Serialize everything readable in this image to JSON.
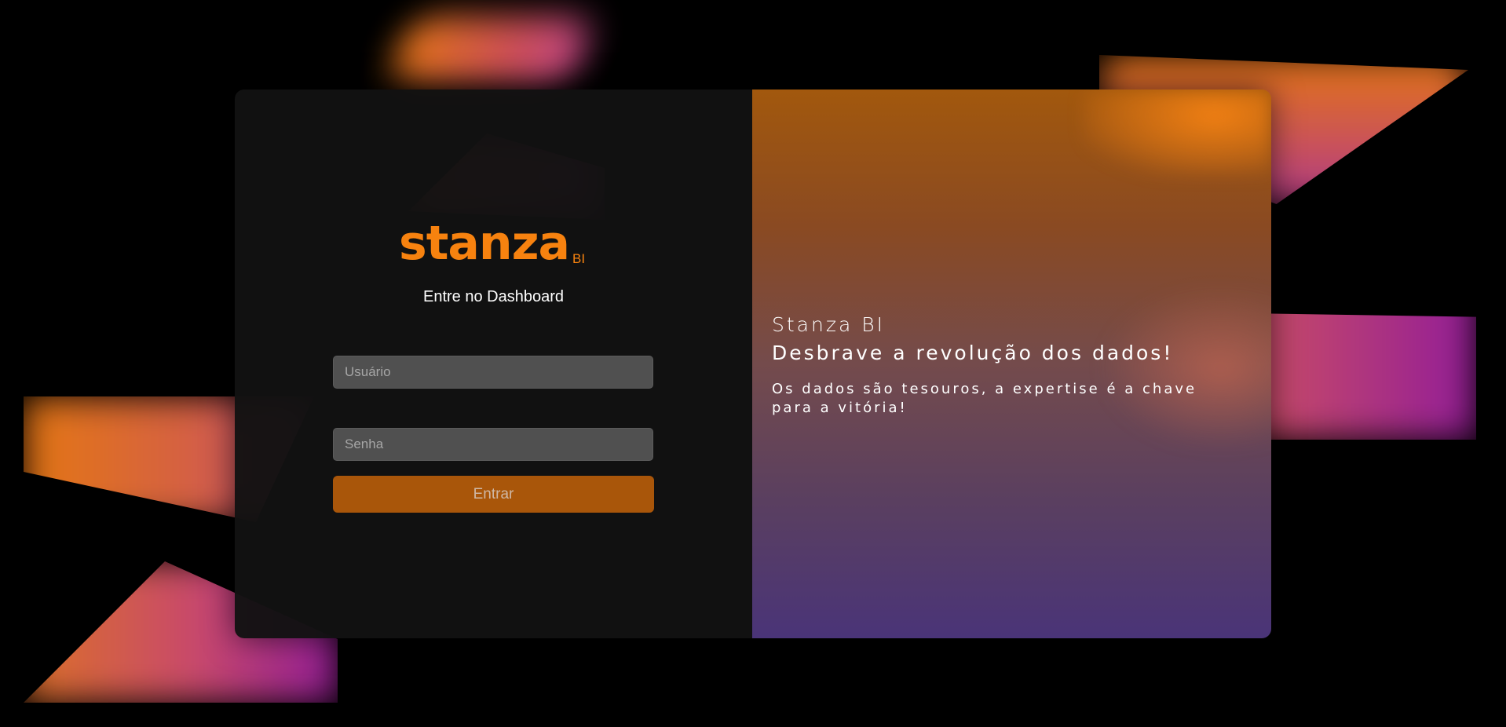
{
  "logo": {
    "word": "stanza",
    "suffix": "BI"
  },
  "login": {
    "heading": "Entre no Dashboard",
    "username_placeholder": "Usuário",
    "password_placeholder": "Senha",
    "submit_label": "Entrar"
  },
  "promo": {
    "brand": "Stanza BI",
    "slogan": "Desbrave a revolução dos dados!",
    "description": "Os dados são tesouros, a expertise é a chave para a vitória!"
  },
  "colors": {
    "accent": "#f7820f",
    "button": "#a9560a",
    "panel_dark": "#121212",
    "gradient_top": "#a2580d",
    "gradient_bottom": "#4a3478"
  }
}
